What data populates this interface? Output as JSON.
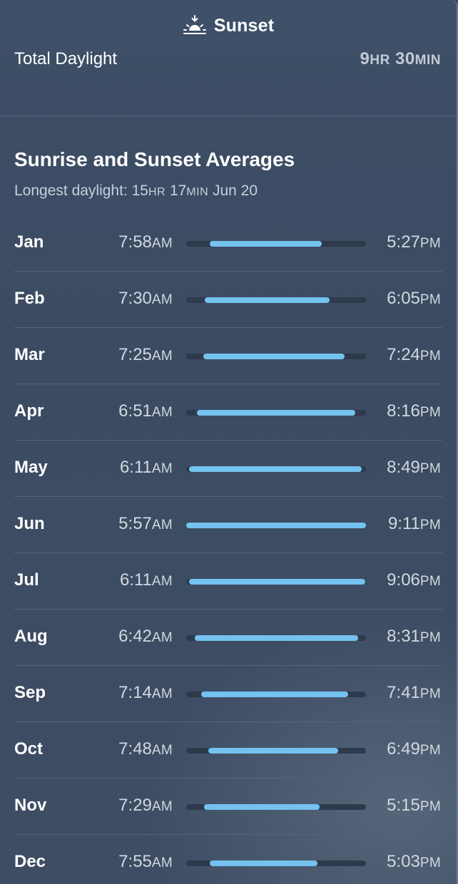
{
  "window": {
    "title": "Sunset",
    "icon": "sunset-icon"
  },
  "daylight": {
    "label": "Total Daylight",
    "hours": "9",
    "hours_unit": "HR",
    "minutes": "30",
    "minutes_unit": "MIN"
  },
  "averages": {
    "title": "Sunrise and Sunset Averages",
    "subtitle_prefix": "Longest daylight: ",
    "longest_hours": "15",
    "longest_hours_unit": "HR",
    "longest_minutes": "17",
    "longest_minutes_unit": "MIN",
    "longest_date": "Jun 20",
    "rows": [
      {
        "month": "Jan",
        "sunrise": "7:58",
        "sunrise_ampm": "AM",
        "sunset": "5:27",
        "sunset_ampm": "PM"
      },
      {
        "month": "Feb",
        "sunrise": "7:30",
        "sunrise_ampm": "AM",
        "sunset": "6:05",
        "sunset_ampm": "PM"
      },
      {
        "month": "Mar",
        "sunrise": "7:25",
        "sunrise_ampm": "AM",
        "sunset": "7:24",
        "sunset_ampm": "PM"
      },
      {
        "month": "Apr",
        "sunrise": "6:51",
        "sunrise_ampm": "AM",
        "sunset": "8:16",
        "sunset_ampm": "PM"
      },
      {
        "month": "May",
        "sunrise": "6:11",
        "sunrise_ampm": "AM",
        "sunset": "8:49",
        "sunset_ampm": "PM"
      },
      {
        "month": "Jun",
        "sunrise": "5:57",
        "sunrise_ampm": "AM",
        "sunset": "9:11",
        "sunset_ampm": "PM"
      },
      {
        "month": "Jul",
        "sunrise": "6:11",
        "sunrise_ampm": "AM",
        "sunset": "9:06",
        "sunset_ampm": "PM"
      },
      {
        "month": "Aug",
        "sunrise": "6:42",
        "sunrise_ampm": "AM",
        "sunset": "8:31",
        "sunset_ampm": "PM"
      },
      {
        "month": "Sep",
        "sunrise": "7:14",
        "sunrise_ampm": "AM",
        "sunset": "7:41",
        "sunset_ampm": "PM"
      },
      {
        "month": "Oct",
        "sunrise": "7:48",
        "sunrise_ampm": "AM",
        "sunset": "6:49",
        "sunset_ampm": "PM"
      },
      {
        "month": "Nov",
        "sunrise": "7:29",
        "sunrise_ampm": "AM",
        "sunset": "5:15",
        "sunset_ampm": "PM"
      },
      {
        "month": "Dec",
        "sunrise": "7:55",
        "sunrise_ampm": "AM",
        "sunset": "5:03",
        "sunset_ampm": "PM"
      }
    ]
  },
  "colors": {
    "bar_fill": "#74c2f0",
    "bar_track": "#2e3a4b",
    "background": "#3b4b62"
  }
}
